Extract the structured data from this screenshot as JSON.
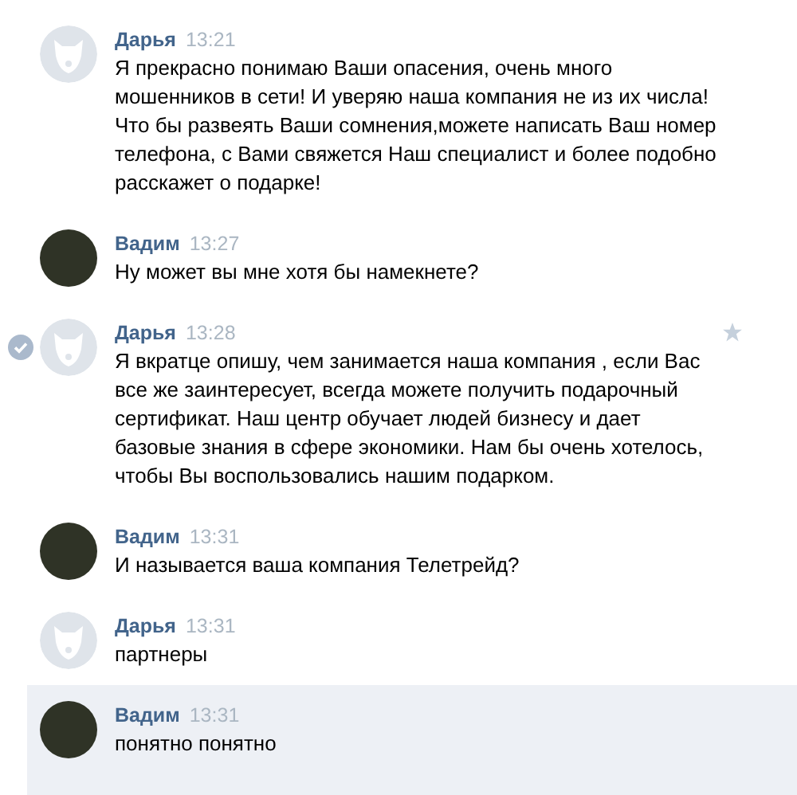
{
  "messages": [
    {
      "author": "Дарья",
      "time": "13:21",
      "kind": "dog",
      "checked": false,
      "starred": false,
      "selected": false,
      "text": "Я прекрасно понимаю Ваши опасения, очень много мошенников в сети! И уверяю наша компания не из их числа! Что бы развеять Ваши сомнения,можете написать Ваш номер телефона, с Вами свяжется Наш специалист и более подобно расскажет о подарке!"
    },
    {
      "author": "Вадим",
      "time": "13:27",
      "kind": "photo",
      "checked": false,
      "starred": false,
      "selected": false,
      "text": "Ну может вы мне хотя бы намекнете?"
    },
    {
      "author": "Дарья",
      "time": "13:28",
      "kind": "dog",
      "checked": true,
      "starred": true,
      "selected": false,
      "text": "Я вкратце опишу, чем занимается наша компания , если Вас все же заинтересует, всегда можете получить подарочный сертификат. Наш центр обучает людей бизнесу и дает базовые знания в сфере экономики. Нам бы очень хотелось, чтобы Вы воспользовались нашим подарком."
    },
    {
      "author": "Вадим",
      "time": "13:31",
      "kind": "photo",
      "checked": false,
      "starred": false,
      "selected": false,
      "text": "И называется ваша компания Телетрейд?"
    },
    {
      "author": "Дарья",
      "time": "13:31",
      "kind": "dog",
      "checked": false,
      "starred": false,
      "selected": false,
      "text": "партнеры"
    },
    {
      "author": "Вадим",
      "time": "13:31",
      "kind": "photo",
      "checked": false,
      "starred": false,
      "selected": true,
      "text": "понятно понятно"
    }
  ]
}
